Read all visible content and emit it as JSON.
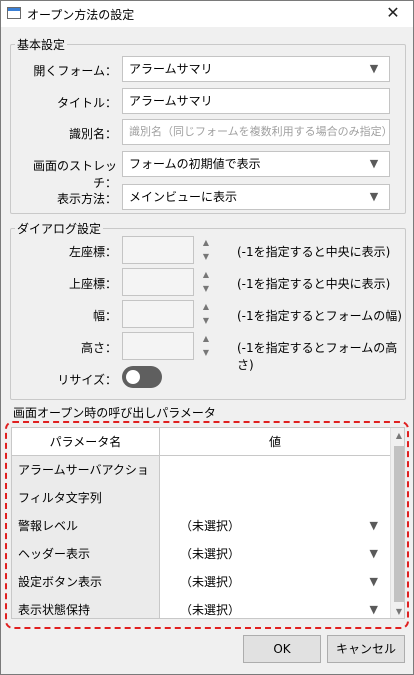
{
  "window": {
    "title": "オープン方法の設定",
    "close_glyph": "✕"
  },
  "basic": {
    "group_title": "基本設定",
    "open_form": {
      "label": "開くフォーム：",
      "value": "アラームサマリ"
    },
    "title": {
      "label": "タイトル：",
      "value": "アラームサマリ"
    },
    "identifier": {
      "label": "識別名：",
      "placeholder": "識別名（同じフォームを複数利用する場合のみ指定）"
    },
    "stretch": {
      "label": "画面のストレッチ：",
      "value": "フォームの初期値で表示"
    },
    "display_method": {
      "label": "表示方法：",
      "value": "メインビューに表示"
    }
  },
  "dialog": {
    "group_title": "ダイアログ設定",
    "left": {
      "label": "左座標：",
      "hint": "(-1を指定すると中央に表示)"
    },
    "top": {
      "label": "上座標：",
      "hint": "(-1を指定すると中央に表示)"
    },
    "width": {
      "label": "幅：",
      "hint": "(-1を指定するとフォームの幅)"
    },
    "height": {
      "label": "高さ：",
      "hint": "(-1を指定するとフォームの高さ)"
    },
    "resize": {
      "label": "リサイズ：",
      "on": false
    }
  },
  "params": {
    "section_title": "画面オープン時の呼び出しパラメータ",
    "col_name": "パラメータ名",
    "col_value": "値",
    "rows": [
      {
        "name": "アラームサーバアクション",
        "value": "",
        "dropdown": false
      },
      {
        "name": "フィルタ文字列",
        "value": "",
        "dropdown": false
      },
      {
        "name": "警報レベル",
        "value": "（未選択）",
        "dropdown": true
      },
      {
        "name": "ヘッダー表示",
        "value": "（未選択）",
        "dropdown": true
      },
      {
        "name": "設定ボタン表示",
        "value": "（未選択）",
        "dropdown": true
      },
      {
        "name": "表示状態保持",
        "value": "（未選択）",
        "dropdown": true
      }
    ]
  },
  "footer": {
    "ok_label": "OK",
    "cancel_label": "キャンセル"
  },
  "icons": {
    "dropdown_arrow": "▼",
    "spin_up": "▲",
    "spin_down": "▼"
  }
}
